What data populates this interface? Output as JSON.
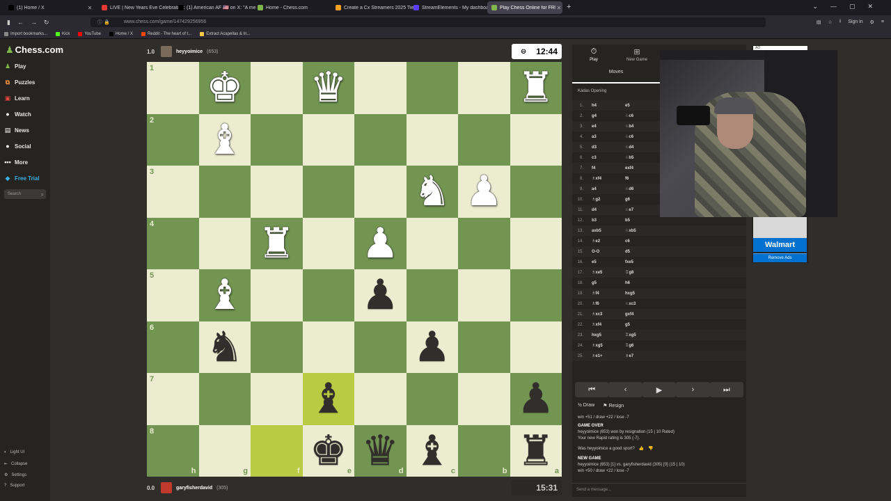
{
  "browser": {
    "tabs": [
      {
        "label": "(1) Home / X",
        "color": "#000000"
      },
      {
        "label": "LIVE | New Years Eve Celebrati",
        "color": "#e53935"
      },
      {
        "label": "(1) American AF 🇺🇸 on X: \"A me",
        "color": "#000000"
      },
      {
        "label": "Home - Chess.com",
        "color": "#81b64c"
      },
      {
        "label": "Create a Cx Streamers 2025 Tie",
        "color": "#f4a020"
      },
      {
        "label": "StreamElements - My dashboa",
        "color": "#5a3df5"
      },
      {
        "label": "Play Chess Online for FREE - 2",
        "color": "#81b64c"
      }
    ],
    "url": "www.chess.com/game/147429256956",
    "bookmarks": [
      "Import bookmarks...",
      "Kick",
      "YouTube",
      "Home / X",
      "Reddit - The heart of t...",
      "Extract Acapellas & In..."
    ],
    "sign_in": "Sign in"
  },
  "sidebar": {
    "logo": "Chess.com",
    "items": [
      {
        "label": "Play",
        "icon": "play-icon",
        "color": "#81b64c"
      },
      {
        "label": "Puzzles",
        "icon": "puzzle-icon",
        "color": "#e98d3a"
      },
      {
        "label": "Learn",
        "icon": "learn-icon",
        "color": "#e0453e"
      },
      {
        "label": "Watch",
        "icon": "watch-icon",
        "color": "#ffffff"
      },
      {
        "label": "News",
        "icon": "news-icon",
        "color": "#ffffff"
      },
      {
        "label": "Social",
        "icon": "social-icon",
        "color": "#ffffff"
      },
      {
        "label": "More",
        "icon": "more-icon",
        "color": "#ffffff"
      },
      {
        "label": "Free Trial",
        "icon": "diamond-icon",
        "color": "#3ab0e8"
      }
    ],
    "search_placeholder": "Search",
    "footer": [
      "Light UI",
      "Collapse",
      "Settings",
      "Support"
    ]
  },
  "top_player": {
    "score": "1.0",
    "name": "heyyoimice",
    "rating": "(653)",
    "clock": "12:44"
  },
  "bottom_player": {
    "score": "0.0",
    "name": "garyfisherdavid",
    "rating": "(305)",
    "clock": "15:31"
  },
  "board": {
    "ranks": [
      "1",
      "2",
      "3",
      "4",
      "5",
      "6",
      "7",
      "8"
    ],
    "files": [
      "h",
      "g",
      "f",
      "e",
      "d",
      "c",
      "b",
      "a"
    ],
    "light_color": "#ebecd0",
    "dark_color": "#739552",
    "highlight": [
      "f8",
      "e7"
    ],
    "pieces": [
      {
        "sq": "g1",
        "p": "♚",
        "c": "w"
      },
      {
        "sq": "e1",
        "p": "♛",
        "c": "w"
      },
      {
        "sq": "a1",
        "p": "♜",
        "c": "w"
      },
      {
        "sq": "g2",
        "p": "♝",
        "c": "w"
      },
      {
        "sq": "c3",
        "p": "♞",
        "c": "w"
      },
      {
        "sq": "b3",
        "p": "♟",
        "c": "w"
      },
      {
        "sq": "f4",
        "p": "♜",
        "c": "w"
      },
      {
        "sq": "d4",
        "p": "♟",
        "c": "w"
      },
      {
        "sq": "g5",
        "p": "♝",
        "c": "w"
      },
      {
        "sq": "d5",
        "p": "♟",
        "c": "b"
      },
      {
        "sq": "g6",
        "p": "♞",
        "c": "b"
      },
      {
        "sq": "c6",
        "p": "♟",
        "c": "b"
      },
      {
        "sq": "e7",
        "p": "♝",
        "c": "b"
      },
      {
        "sq": "a7",
        "p": "♟",
        "c": "b"
      },
      {
        "sq": "e8",
        "p": "♚",
        "c": "b"
      },
      {
        "sq": "d8",
        "p": "♛",
        "c": "b"
      },
      {
        "sq": "c8",
        "p": "♝",
        "c": "b"
      },
      {
        "sq": "a8",
        "p": "♜",
        "c": "b"
      }
    ]
  },
  "panel": {
    "tabs": [
      {
        "label": "Play",
        "icon": "stopwatch-icon"
      },
      {
        "label": "New Game",
        "icon": "plus-icon"
      }
    ],
    "moves_tab": "Moves",
    "opening": "Kádas Opening",
    "moves": [
      {
        "n": "1.",
        "w": "h4",
        "b": "e5"
      },
      {
        "n": "2.",
        "w": "g4",
        "b": "♘c6"
      },
      {
        "n": "3.",
        "w": "e4",
        "b": "♘b4"
      },
      {
        "n": "4.",
        "w": "a3",
        "b": "♘c6"
      },
      {
        "n": "5.",
        "w": "d3",
        "b": "♘d4"
      },
      {
        "n": "6.",
        "w": "c3",
        "b": "♘b5"
      },
      {
        "n": "7.",
        "w": "f4",
        "b": "exf4"
      },
      {
        "n": "8.",
        "w": "♗xf4",
        "b": "f6"
      },
      {
        "n": "9.",
        "w": "a4",
        "b": "♘d6"
      },
      {
        "n": "10.",
        "w": "♗g2",
        "b": "g6"
      },
      {
        "n": "11.",
        "w": "d4",
        "b": "♘e7"
      },
      {
        "n": "12.",
        "w": "b3",
        "b": "b5"
      },
      {
        "n": "13.",
        "w": "axb5",
        "b": "♘xb5"
      },
      {
        "n": "14.",
        "w": "♗e2",
        "b": "c6"
      },
      {
        "n": "15.",
        "w": "O-O",
        "b": "d5"
      },
      {
        "n": "16.",
        "w": "e5",
        "b": "fxe5"
      },
      {
        "n": "17.",
        "w": "♗xe5",
        "b": "♖g8"
      },
      {
        "n": "18.",
        "w": "g5",
        "b": "h6"
      },
      {
        "n": "19.",
        "w": "♗f4",
        "b": "hxg5"
      },
      {
        "n": "20.",
        "w": "♗f6",
        "b": "♘xc3"
      },
      {
        "n": "21.",
        "w": "♗xc3",
        "b": "gxf4"
      },
      {
        "n": "22.",
        "w": "♗xf4",
        "b": "g5"
      },
      {
        "n": "23.",
        "w": "hxg5",
        "b": "♖xg5"
      },
      {
        "n": "24.",
        "w": "♗xg5",
        "b": "♖g6"
      },
      {
        "n": "25.",
        "w": "♗e1+",
        "b": "♗e7"
      }
    ],
    "controls": [
      "⏮",
      "‹",
      "▶",
      "›",
      "⏭"
    ],
    "draw": "Draw",
    "resign": "Resign",
    "record1": "win +51 / draw +22 / lose -7",
    "game_over": "GAME OVER",
    "result": "heyyoimice (653) won by resignation (15 | 10 Rated)",
    "rating_change": "Your new Rapid rating is 305 (-7).",
    "sport_q": "Was heyyoimice a good sport?",
    "new_game": "NEW GAME",
    "vs": "heyyoimice (653) [1] vs. garyfisherdavid (305) [0] (15 | 10)",
    "record2": "win +50 / draw +22 / lose -7",
    "message_placeholder": "Send a message..."
  },
  "ad": {
    "tag": "AD",
    "brand": "Walmart",
    "remove": "Remove Ads"
  }
}
